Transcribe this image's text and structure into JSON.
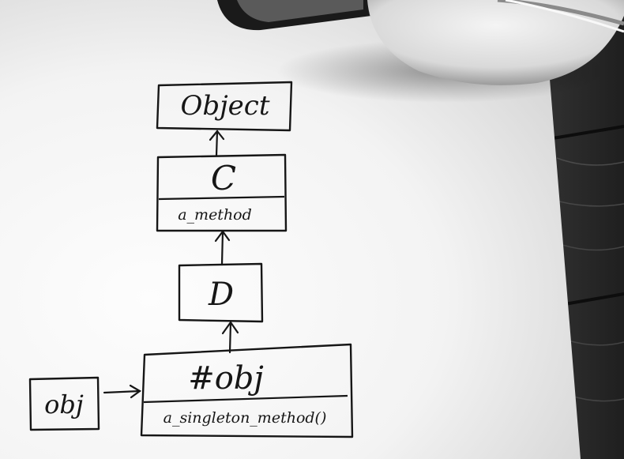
{
  "diagram": {
    "nodes": [
      {
        "id": "object",
        "label": "Object"
      },
      {
        "id": "c",
        "label": "C",
        "method": "a_method"
      },
      {
        "id": "d",
        "label": "D"
      },
      {
        "id": "singleton",
        "label": "#obj",
        "method": "a_singleton_method()"
      },
      {
        "id": "obj",
        "label": "obj"
      }
    ],
    "edges": [
      {
        "from": "c",
        "to": "object"
      },
      {
        "from": "d",
        "to": "c"
      },
      {
        "from": "singleton",
        "to": "d"
      },
      {
        "from": "obj",
        "to": "singleton"
      }
    ]
  }
}
